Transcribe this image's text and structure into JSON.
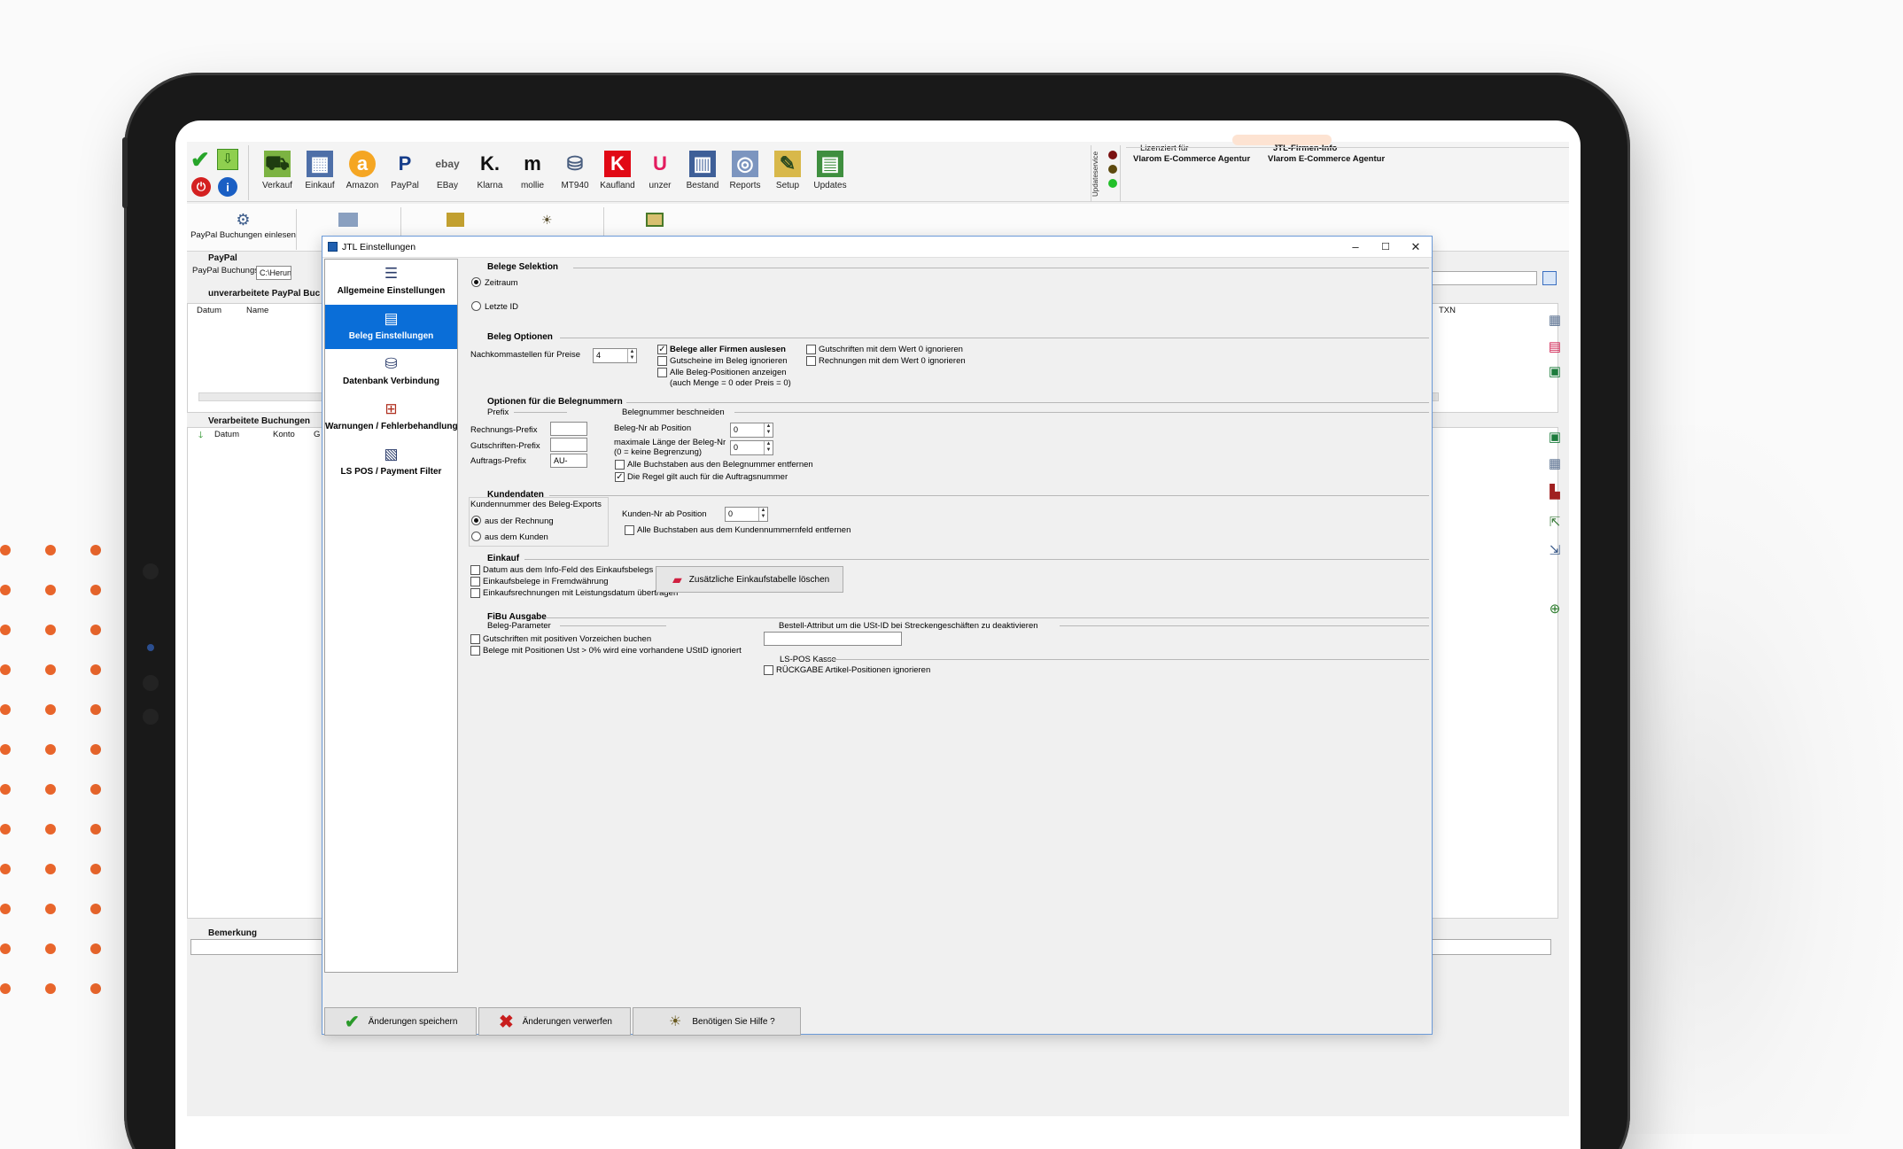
{
  "toolbar": {
    "items": [
      {
        "label": "Verkauf",
        "icon": "cart-icon"
      },
      {
        "label": "Einkauf",
        "icon": "purchase-icon"
      },
      {
        "label": "Amazon",
        "icon": "amazon-icon",
        "glyph": "a"
      },
      {
        "label": "PayPal",
        "icon": "paypal-icon",
        "glyph": "P"
      },
      {
        "label": "EBay",
        "icon": "ebay-icon",
        "glyph": "ebay"
      },
      {
        "label": "Klarna",
        "icon": "klarna-icon",
        "glyph": "K."
      },
      {
        "label": "mollie",
        "icon": "mollie-icon",
        "glyph": "m"
      },
      {
        "label": "MT940",
        "icon": "bank-icon"
      },
      {
        "label": "Kaufland",
        "icon": "kaufland-icon",
        "glyph": "K"
      },
      {
        "label": "unzer",
        "icon": "unzer-icon",
        "glyph": "U"
      },
      {
        "label": "Bestand",
        "icon": "inventory-icon"
      },
      {
        "label": "Reports",
        "icon": "reports-icon"
      },
      {
        "label": "Setup",
        "icon": "setup-icon"
      },
      {
        "label": "Updates",
        "icon": "updates-icon"
      }
    ],
    "updateservice": "Updateservice",
    "licensed_label": "Lizenziert für",
    "licensed_value": "Vlarom E-Commerce Agentur",
    "firm_label": "JTL-Firmen-Info",
    "firm_value": "Vlarom E-Commerce Agentur"
  },
  "background": {
    "paypal_read_button": "PayPal Buchungen einlesen",
    "paypal_group": "PayPal",
    "buchungsdatei_label": "PayPal Buchungsdatei",
    "buchungsdatei_value": "C:\\Herunt",
    "unverarbeitet_title": "unverarbeitete PayPal Buc",
    "col_datum": "Datum",
    "col_name": "Name",
    "col_txn": "TXN",
    "verarbeitet_title": "Verarbeitete Buchungen",
    "col_datum2": "Datum",
    "col_konto": "Konto",
    "col_g": "G",
    "bemerkung": "Bemerkung"
  },
  "dialog": {
    "title": "JTL Einstellungen",
    "nav": [
      {
        "label": "Allgemeine Einstellungen"
      },
      {
        "label": "Beleg Einstellungen"
      },
      {
        "label": "Datenbank Verbindung"
      },
      {
        "label": "Warnungen / Fehlerbehandlung"
      },
      {
        "label": "LS POS / Payment Filter"
      }
    ],
    "belege_selektion": {
      "title": "Belege Selektion",
      "zeitraum": "Zeitraum",
      "letzte_id": "Letzte ID"
    },
    "beleg_optionen": {
      "title": "Beleg Optionen",
      "nachkomma_label": "Nachkommastellen für Preise",
      "nachkomma_value": "4",
      "alle_firmen": "Belege aller Firmen auslesen",
      "gutscheine": "Gutscheine im Beleg ignorieren",
      "alle_positionen": "Alle Beleg-Positionen anzeigen",
      "alle_positionen_note": "(auch Menge = 0 oder Preis = 0)",
      "gutschriften_0": "Gutschriften mit dem Wert 0 ignorieren",
      "rechnungen_0": "Rechnungen mit dem Wert 0 ignorieren"
    },
    "belegnummern": {
      "title": "Optionen für die Belegnummern",
      "prefix": "Prefix",
      "rechnungs_prefix": "Rechnungs-Prefix",
      "gutschriften_prefix": "Gutschriften-Prefix",
      "auftrags_prefix": "Auftrags-Prefix",
      "auftrags_prefix_value": "AU-",
      "beschneiden": "Belegnummer beschneiden",
      "ab_position": "Beleg-Nr ab Position",
      "ab_position_value": "0",
      "max_laenge": "maximale Länge der Beleg-Nr",
      "max_laenge_note": "(0 = keine Begrenzung)",
      "max_laenge_value": "0",
      "alle_buchstaben": "Alle Buchstaben aus den Belegnummer entfernen",
      "regel_auftrag": "Die Regel gilt auch für die Auftragsnummer"
    },
    "kundendaten": {
      "title": "Kundendaten",
      "sub": "Kundennummer des Beleg-Exports",
      "aus_rechnung": "aus der Rechnung",
      "aus_kunden": "aus dem Kunden",
      "kunden_ab": "Kunden-Nr ab Position",
      "kunden_ab_value": "0",
      "alle_buchstaben": "Alle Buchstaben aus dem Kundennummernfeld entfernen"
    },
    "einkauf": {
      "title": "Einkauf",
      "datum_info": "Datum aus dem Info-Feld des Einkaufsbelegs",
      "fremdwaehrung": "Einkaufsbelege in Fremdwährung",
      "leistungsdatum": "Einkaufsrechnungen mit Leistungsdatum übertragen",
      "loeschen_button": "Zusätzliche Einkaufstabelle löschen"
    },
    "fibu": {
      "title": "FiBu Ausgabe",
      "beleg_parameter": "Beleg-Parameter",
      "gutschriften_positiv": "Gutschriften mit positiven Vorzeichen buchen",
      "ust_positionen": "Belege mit Positionen Ust > 0% wird eine vorhandene UStID ignoriert",
      "bestell_attribut": "Bestell-Attribut um die USt-ID bei Streckengeschäften zu deaktivieren",
      "ls_pos": "LS-POS Kasse",
      "rueckgabe": "RÜCKGABE Artikel-Positionen ignorieren"
    },
    "footer": {
      "save": "Änderungen speichern",
      "discard": "Änderungen verwerfen",
      "help": "Benötigen Sie Hilfe ?"
    }
  },
  "colors": {
    "accent": "#0a6ed8",
    "brand_orange": "#e8652b",
    "led_red": "#8b1a1a",
    "led_yellow": "#6b5a1a",
    "led_green": "#1fbf2a"
  }
}
